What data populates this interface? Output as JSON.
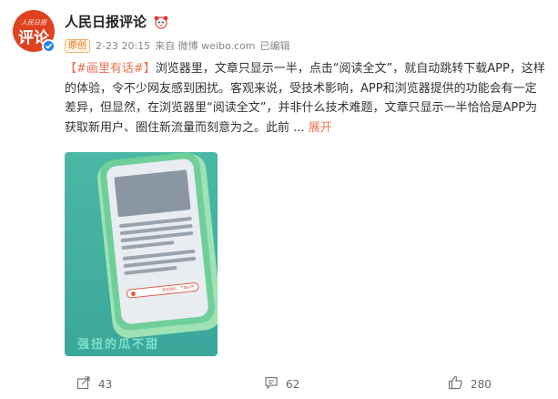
{
  "author": {
    "name": "人民日报评论",
    "avatar_top_text": "人民日报",
    "avatar_main_text": "评论",
    "verified_icon": "verified-check-icon",
    "badge_icon": "cute-emoji-badge-icon"
  },
  "meta": {
    "original_badge": "原创",
    "timestamp": "2-23 20:15",
    "source": "来自 微博 weibo.com",
    "edited": "已编辑"
  },
  "post": {
    "tag": "【#画里有话#】",
    "text": "浏览器里，文章只显示一半，点击“阅读全文”，就自动跳转下载APP，这样的体验，令不少网友感到困扰。客观来说，受技术影响，APP和浏览器提供的功能会有一定差异，但显然，在浏览器里“阅读全文”，并非什么技术难题，文章只显示一半恰恰是APP为获取新用户、圈住新流量而刻意为之。此前 ...",
    "expand_label": "展开"
  },
  "image": {
    "caption": "强扭的瓜不甜",
    "pill_text": "更多精彩，下载APP",
    "colors": {
      "background": "#41ad9e",
      "phone": "#6fcf9a",
      "accent": "#e05d4a"
    }
  },
  "actions": {
    "share_count": "43",
    "comment_count": "62",
    "like_count": "280"
  }
}
